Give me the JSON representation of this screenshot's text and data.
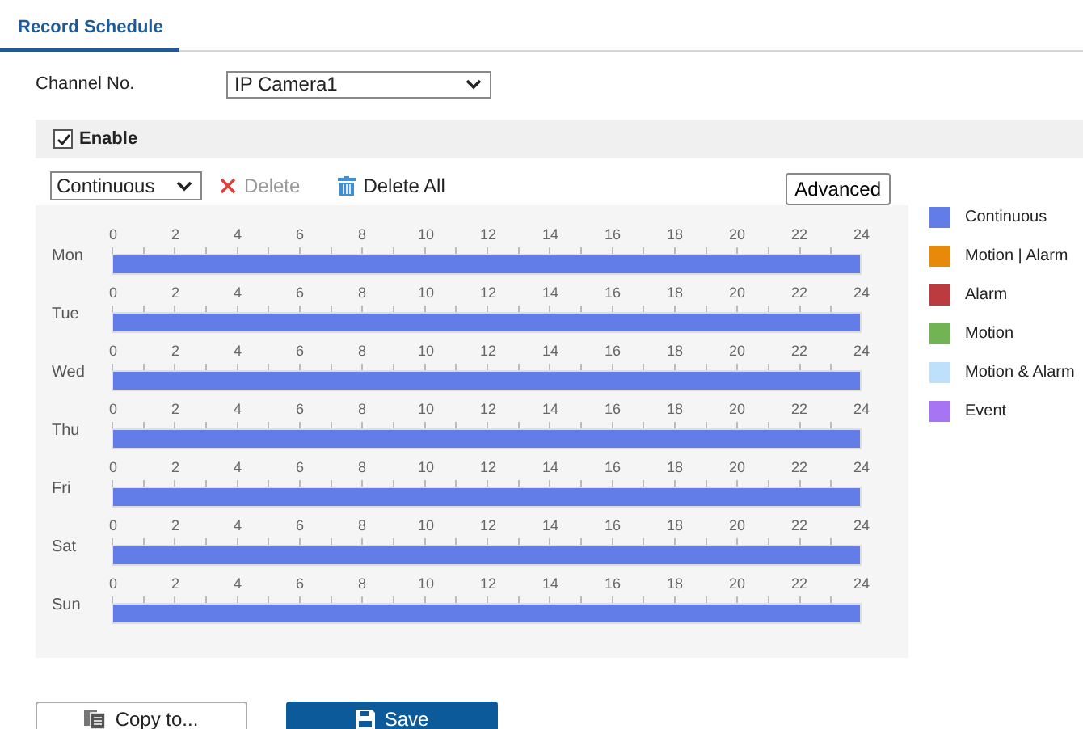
{
  "tabs": [
    {
      "label": "Record Schedule",
      "selected": true
    }
  ],
  "channel": {
    "label": "Channel No.",
    "value": "IP Camera1"
  },
  "enable": {
    "label": "Enable",
    "checked": true
  },
  "toolbar": {
    "type_value": "Continuous",
    "delete": {
      "label": "Delete",
      "disabled": true
    },
    "delete_all": {
      "label": "Delete All",
      "disabled": false
    },
    "advanced": "Advanced"
  },
  "days": [
    {
      "label": "Mon",
      "ticks": [
        "0",
        "2",
        "4",
        "6",
        "8",
        "10",
        "12",
        "14",
        "16",
        "18",
        "20",
        "22",
        "24"
      ],
      "level": 1,
      "kind": "continuous"
    },
    {
      "label": "Tue",
      "ticks": [
        "0",
        "2",
        "4",
        "6",
        "8",
        "10",
        "12",
        "14",
        "16",
        "18",
        "20",
        "22",
        "24"
      ],
      "level": 1,
      "kind": "continuous"
    },
    {
      "label": "Wed",
      "ticks": [
        "0",
        "2",
        "4",
        "6",
        "8",
        "10",
        "12",
        "14",
        "16",
        "18",
        "20",
        "22",
        "24"
      ],
      "level": 1,
      "kind": "continuous"
    },
    {
      "label": "Thu",
      "ticks": [
        "0",
        "2",
        "4",
        "6",
        "8",
        "10",
        "12",
        "14",
        "16",
        "18",
        "20",
        "22",
        "24"
      ],
      "level": 1,
      "kind": "continuous"
    },
    {
      "label": "Fri",
      "ticks": [
        "0",
        "2",
        "4",
        "6",
        "8",
        "10",
        "12",
        "14",
        "16",
        "18",
        "20",
        "22",
        "24"
      ],
      "level": 1,
      "kind": "continuous"
    },
    {
      "label": "Sat",
      "ticks": [
        "0",
        "2",
        "4",
        "6",
        "8",
        "10",
        "12",
        "14",
        "16",
        "18",
        "20",
        "22",
        "24"
      ],
      "level": 1,
      "kind": "continuous"
    },
    {
      "label": "Sun",
      "ticks": [
        "0",
        "2",
        "4",
        "6",
        "8",
        "10",
        "12",
        "14",
        "16",
        "18",
        "20",
        "22",
        "24"
      ],
      "level": 1,
      "kind": "continuous"
    }
  ],
  "legend": [
    {
      "label": "Continuous",
      "kind": "continuous",
      "color": "#637de8"
    },
    {
      "label": "Motion | Alarm",
      "kind": "motionoralarm",
      "color": "#e8890a"
    },
    {
      "label": "Alarm",
      "kind": "alarm",
      "color": "#bc3b3f"
    },
    {
      "label": "Motion",
      "kind": "motion",
      "color": "#72b354"
    },
    {
      "label": "Motion & Alarm",
      "kind": "motionandalarm",
      "color": "#bde1fb"
    },
    {
      "label": "Event",
      "kind": "event",
      "color": "#a774f4"
    }
  ],
  "buttons": [
    {
      "label": "Copy to...",
      "kind": "secondary"
    },
    {
      "label": "Save",
      "kind": "primary"
    }
  ]
}
